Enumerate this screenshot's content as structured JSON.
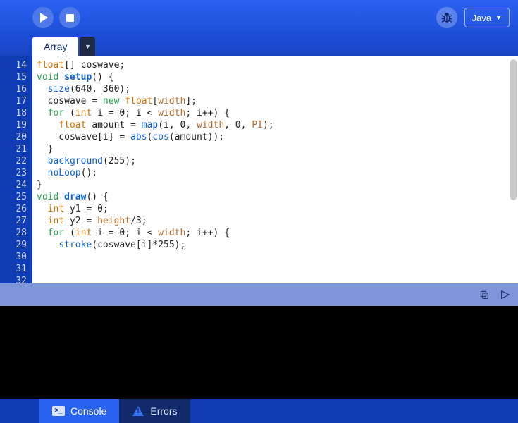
{
  "toolbar": {
    "language": "Java"
  },
  "tabs": {
    "active": "Array"
  },
  "editor": {
    "firstLine": 14,
    "lines": [
      [
        [
          "type",
          "float"
        ],
        [
          "",
          "[] coswave;"
        ]
      ],
      [
        [
          "",
          ""
        ]
      ],
      [
        [
          "kw",
          "void"
        ],
        [
          "",
          " "
        ],
        [
          "fn",
          "setup"
        ],
        [
          "",
          "() {"
        ]
      ],
      [
        [
          "",
          "  "
        ],
        [
          "call",
          "size"
        ],
        [
          "",
          "(640, 360);"
        ]
      ],
      [
        [
          "",
          "  coswave = "
        ],
        [
          "kw",
          "new"
        ],
        [
          "",
          " "
        ],
        [
          "type",
          "float"
        ],
        [
          "",
          "["
        ],
        [
          "var",
          "width"
        ],
        [
          "",
          "];"
        ]
      ],
      [
        [
          "",
          "  "
        ],
        [
          "kw",
          "for"
        ],
        [
          "",
          " ("
        ],
        [
          "type",
          "int"
        ],
        [
          "",
          " i = 0; i < "
        ],
        [
          "var",
          "width"
        ],
        [
          "",
          "; i++) {"
        ]
      ],
      [
        [
          "",
          "    "
        ],
        [
          "type",
          "float"
        ],
        [
          "",
          " amount = "
        ],
        [
          "call",
          "map"
        ],
        [
          "",
          "(i, 0, "
        ],
        [
          "var",
          "width"
        ],
        [
          "",
          ", 0, "
        ],
        [
          "var",
          "PI"
        ],
        [
          "",
          ");"
        ]
      ],
      [
        [
          "",
          "    coswave[i] = "
        ],
        [
          "call",
          "abs"
        ],
        [
          "",
          "("
        ],
        [
          "call",
          "cos"
        ],
        [
          "",
          "(amount));"
        ]
      ],
      [
        [
          "",
          "  }"
        ]
      ],
      [
        [
          "",
          "  "
        ],
        [
          "call",
          "background"
        ],
        [
          "",
          "(255);"
        ]
      ],
      [
        [
          "",
          "  "
        ],
        [
          "call",
          "noLoop"
        ],
        [
          "",
          "();"
        ]
      ],
      [
        [
          "",
          "}"
        ]
      ],
      [
        [
          "",
          ""
        ]
      ],
      [
        [
          "kw",
          "void"
        ],
        [
          "",
          " "
        ],
        [
          "fn",
          "draw"
        ],
        [
          "",
          "() {"
        ]
      ],
      [
        [
          "",
          ""
        ]
      ],
      [
        [
          "",
          "  "
        ],
        [
          "type",
          "int"
        ],
        [
          "",
          " y1 = 0;"
        ]
      ],
      [
        [
          "",
          "  "
        ],
        [
          "type",
          "int"
        ],
        [
          "",
          " y2 = "
        ],
        [
          "var",
          "height"
        ],
        [
          "",
          "/3;"
        ]
      ],
      [
        [
          "",
          "  "
        ],
        [
          "kw",
          "for"
        ],
        [
          "",
          " ("
        ],
        [
          "type",
          "int"
        ],
        [
          "",
          " i = 0; i < "
        ],
        [
          "var",
          "width"
        ],
        [
          "",
          "; i++) {"
        ]
      ],
      [
        [
          "",
          "    "
        ],
        [
          "call",
          "stroke"
        ],
        [
          "",
          "(coswave[i]*255);"
        ]
      ]
    ]
  },
  "bottom": {
    "console": "Console",
    "errors": "Errors"
  }
}
